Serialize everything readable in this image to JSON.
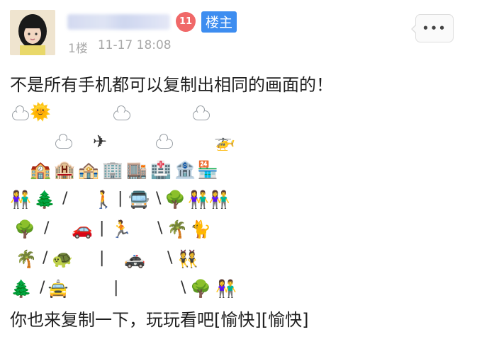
{
  "header": {
    "level": "11",
    "owner_badge": "楼主",
    "floor": "1楼",
    "timestamp": "11-17 18:08",
    "more_label": "•••"
  },
  "post": {
    "line1": "不是所有手机都可以复制出相同的画面的！",
    "line_final": "你也来复制一下，玩玩看吧[愉快][愉快]",
    "row1": {
      "sun": "🌞"
    },
    "row2": {
      "airplane": "✈",
      "helicopter": "🚁"
    },
    "row3": {
      "buildings": [
        "🏫",
        "🏨",
        "🏤",
        "🏢",
        "🏬",
        "🏥",
        "🏦",
        "🏪"
      ]
    },
    "row4": {
      "people_left": "👫",
      "tree": "🌲",
      "slash": "/",
      "runner": "🚶",
      "bar": "|",
      "bus": "🚍",
      "backslash": "\\",
      "tree2": "🌳",
      "people_right": "👫👫"
    },
    "row5": {
      "tree": "🌳",
      "slash": "/",
      "car": "🚗",
      "bar": "|",
      "runner": "🏃",
      "backslash": "\\",
      "palm": "🌴",
      "cat": "🐈"
    },
    "row6": {
      "palm": "🌴",
      "slash": "/",
      "turtle": "🐢",
      "bar": "|",
      "police": "🚓",
      "backslash": "\\",
      "bunny": "👯"
    },
    "row7": {
      "tree": "🌲",
      "slash": "/",
      "taxi": "🚖",
      "bar": "|",
      "backslash": "\\",
      "tree2": "🌳",
      "people": "👫"
    }
  },
  "colors": {
    "owner_badge_bg": "#3d8df0",
    "level_badge_bg": "#f06868",
    "meta_text": "#a8a8a8"
  }
}
